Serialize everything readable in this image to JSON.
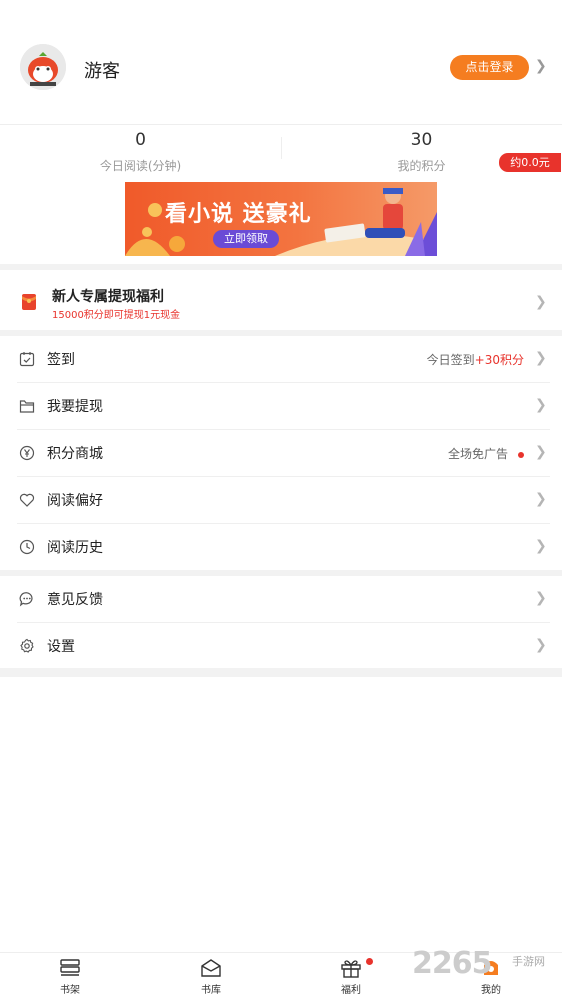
{
  "header": {
    "username": "游客",
    "login_label": "点击登录"
  },
  "stats": {
    "read_value": "0",
    "read_label": "今日阅读(分钟)",
    "points_value": "30",
    "points_label": "我的积分",
    "money_badge": "约0.0元"
  },
  "banner": {
    "title": "看小说  送豪礼",
    "button": "立即领取"
  },
  "promo": {
    "title": "新人专属提现福利",
    "subtitle": "15000积分即可提现1元现金"
  },
  "menu": [
    {
      "label": "签到",
      "right_prefix": "今日签到",
      "right_highlight": "+30积分",
      "icon": "calendar-check-icon"
    },
    {
      "label": "我要提现",
      "icon": "wallet-icon"
    },
    {
      "label": "积分商城",
      "right_highlight": "全场免广告",
      "icon": "yen-coin-icon"
    },
    {
      "label": "阅读偏好",
      "icon": "heart-icon"
    },
    {
      "label": "阅读历史",
      "icon": "clock-icon"
    },
    {
      "label": "意见反馈",
      "icon": "chat-bubble-icon"
    },
    {
      "label": "设置",
      "icon": "gear-icon"
    }
  ],
  "tabbar": [
    {
      "label": "书架",
      "icon": "bookshelf-icon"
    },
    {
      "label": "书库",
      "icon": "library-icon"
    },
    {
      "label": "福利",
      "icon": "gift-icon"
    },
    {
      "label": "我的",
      "icon": "profile-icon"
    }
  ],
  "watermark": {
    "text": "2265",
    "sub": "手游网"
  },
  "colors": {
    "accent": "#f57d20",
    "red": "#e8332c",
    "banner_button": "#6a4bd6"
  }
}
